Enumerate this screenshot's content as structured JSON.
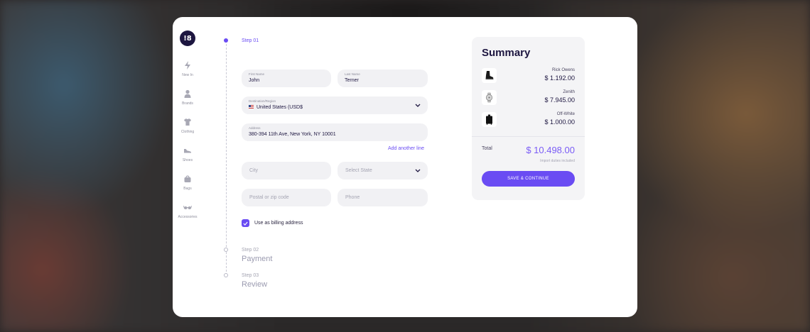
{
  "brand": {
    "logo_text": "!8"
  },
  "nav": {
    "items": [
      {
        "label": "New In",
        "icon": "bolt-icon"
      },
      {
        "label": "Brands",
        "icon": "person-icon"
      },
      {
        "label": "Clothing",
        "icon": "tshirt-icon"
      },
      {
        "label": "Shoes",
        "icon": "shoe-icon"
      },
      {
        "label": "Bags",
        "icon": "bag-icon"
      },
      {
        "label": "Accessories",
        "icon": "glasses-icon"
      }
    ]
  },
  "steps": {
    "step1_label": "Step 01",
    "step2_label": "Step 02",
    "step2_title": "Payment",
    "step3_label": "Step 03",
    "step3_title": "Review"
  },
  "form": {
    "first_name": {
      "label": "First Name",
      "value": "John"
    },
    "last_name": {
      "label": "Last Name",
      "value": "Terner"
    },
    "destination": {
      "label": "Destination/Region",
      "value": "United States (USD$"
    },
    "address": {
      "label": "Address",
      "value": "380-394 11th Ave, New York, NY 10001"
    },
    "add_line": "Add another line",
    "city_placeholder": "City",
    "state_placeholder": "Select State",
    "postal_placeholder": "Postal or zip code",
    "phone_placeholder": "Phone",
    "billing_label": "Use as billing address",
    "billing_checked": true
  },
  "summary": {
    "title": "Summary",
    "items": [
      {
        "name": "Rick Owens",
        "price": "$ 1.192.00",
        "icon": "boot-icon"
      },
      {
        "name": "Zenith",
        "price": "$ 7.945.00",
        "icon": "watch-icon"
      },
      {
        "name": "Off-White",
        "price": "$ 1.000.00",
        "icon": "suitcase-icon"
      }
    ],
    "total_label": "Total",
    "total_value": "$ 10.498.00",
    "duties_note": "Import duties included",
    "save_button": "SAVE & CONTINUE"
  },
  "colors": {
    "accent": "#6a4cf3",
    "brand_dark": "#1d1640"
  }
}
